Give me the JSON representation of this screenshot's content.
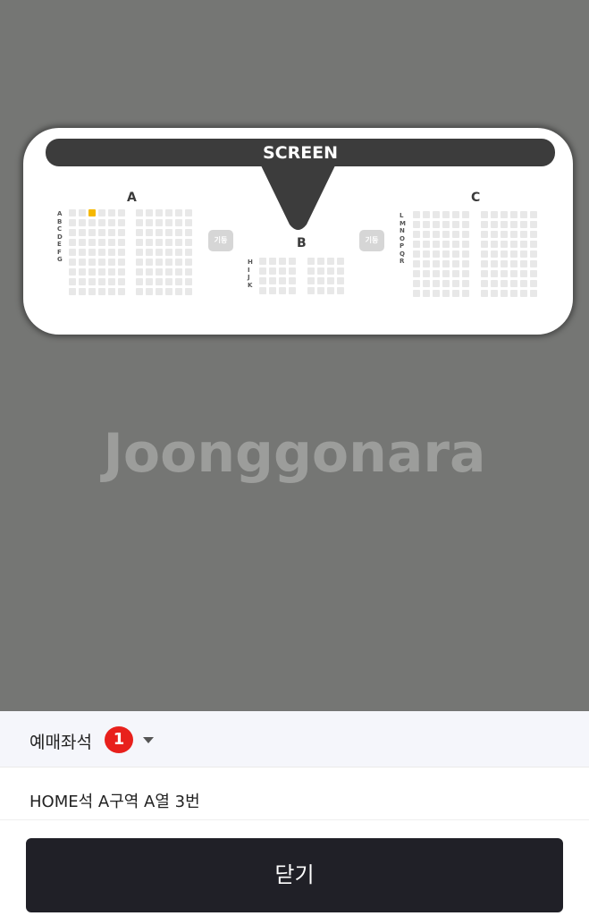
{
  "seatmap": {
    "screen_label": "SCREEN",
    "sections": {
      "A": {
        "label": "A",
        "rows": [
          "A",
          "B",
          "C",
          "D",
          "E",
          "F",
          "G"
        ]
      },
      "B": {
        "label": "B",
        "rows": [
          "H",
          "I",
          "J",
          "K"
        ]
      },
      "C": {
        "label": "C",
        "rows": [
          "L",
          "M",
          "N",
          "O",
          "P",
          "Q",
          "R"
        ]
      }
    },
    "aisle_label": "기둥",
    "selected_seat": {
      "section": "A",
      "row": "A",
      "number": 3
    },
    "colors": {
      "selected": "#f5b800",
      "seat": "#e8e8e8",
      "screen": "#3c3c3c"
    }
  },
  "watermark": "Joonggonara",
  "sheet": {
    "title": "예매좌석",
    "count": "1",
    "seat_info": "HOME석 A구역 A열 3번",
    "close_label": "닫기"
  }
}
